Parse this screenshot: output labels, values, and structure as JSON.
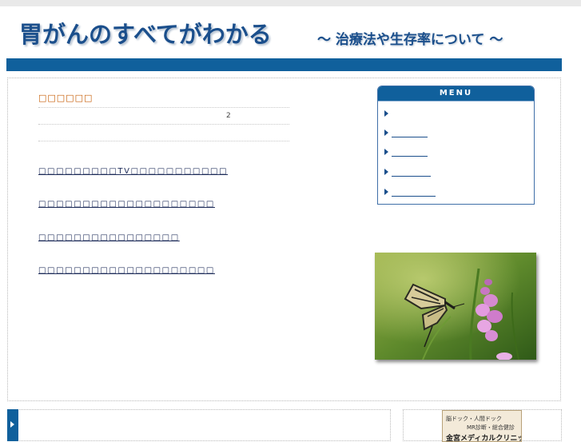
{
  "header": {
    "title": "胃がんのすべてがわかる",
    "subtitle": "～ 治療法や生存率について ～"
  },
  "news": {
    "heading": "□□□□□□",
    "page_number": "2"
  },
  "links": [
    "□□□□□□□□□TV□□□□□□□□□□□",
    "□□□□□□□□□□□□□□□□□□□□",
    "□□□□□□□□□□□□□□□□",
    "□□□□□□□□□□□□□□□□□□□□"
  ],
  "menu": {
    "title": "MENU",
    "items": [
      "",
      "",
      "",
      "",
      ""
    ]
  },
  "banner": {
    "line1": "脳ドック・人間ドック",
    "line2": "MR診断・総合健診",
    "line3": "金宮メディカルクリニック"
  },
  "photo": {
    "icon": "butterfly-on-flower-image"
  }
}
